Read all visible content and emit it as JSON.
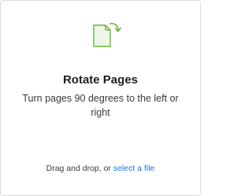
{
  "tool": {
    "icon": "rotate-pages-icon",
    "title": "Rotate Pages",
    "description": "Turn pages 90 degrees to the left or right"
  },
  "footer": {
    "prefix": "Drag and drop, or ",
    "link_label": "select a file"
  },
  "colors": {
    "icon_green": "#6cb33f",
    "icon_fill": "#eef6e6",
    "link_blue": "#1473e6"
  }
}
